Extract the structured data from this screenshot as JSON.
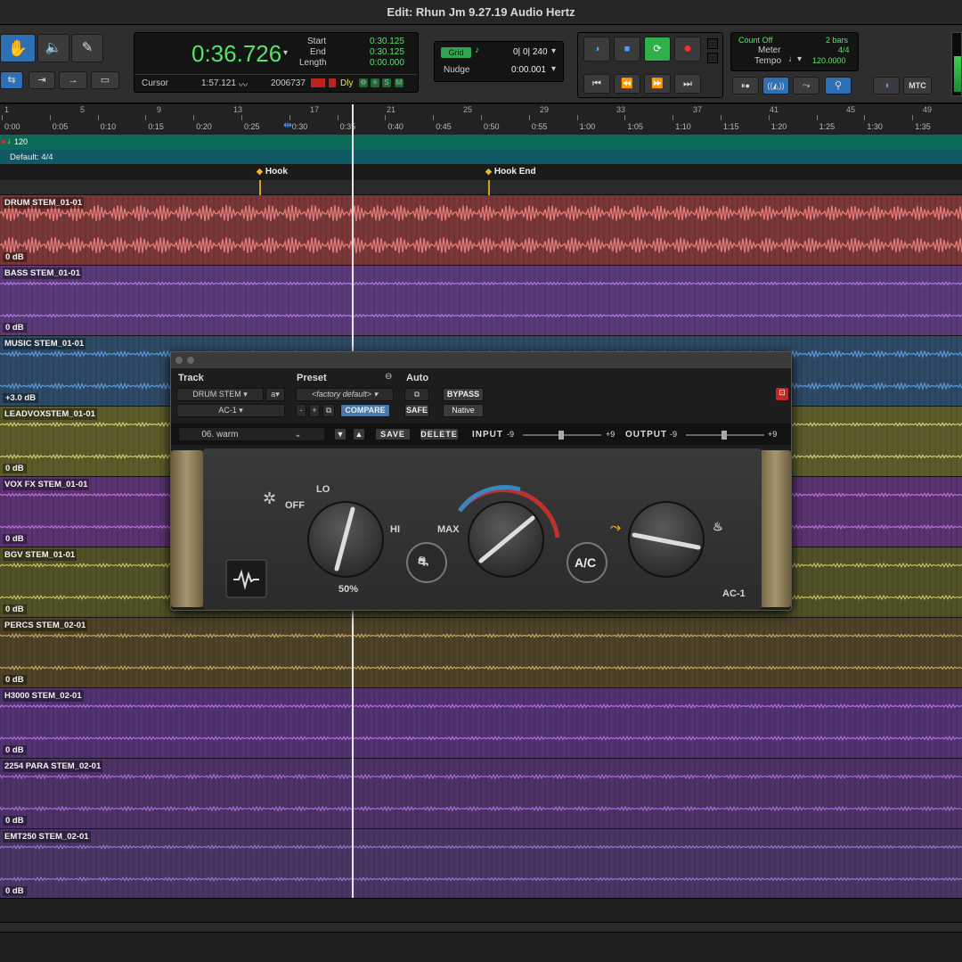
{
  "window": {
    "title": "Edit: Rhun Jm 9.27.19 Audio Hertz"
  },
  "counter": {
    "main": "0:36.726",
    "start_label": "Start",
    "end_label": "End",
    "length_label": "Length",
    "start": "0:30.125",
    "end": "0:30.125",
    "length": "0:00.000",
    "cursor_label": "Cursor",
    "cursor": "1:57.121",
    "sample": "2006737",
    "dly": "Dly",
    "btn_o": "O",
    "btn_s": "S",
    "btn_m": "M"
  },
  "grid": {
    "label": "Grid",
    "value": "0| 0| 240",
    "nudge_label": "Nudge",
    "nudge_value": "0:00.001"
  },
  "midi": {
    "count_off": "Count Off",
    "count_off_value": "2 bars",
    "meter_label": "Meter",
    "meter_value": "4/4",
    "tempo_label": "Tempo",
    "tempo_value": "120.0000",
    "mtc": "MTC"
  },
  "ruler": {
    "bars": [
      "1",
      "5",
      "9",
      "13",
      "17",
      "21",
      "25",
      "29",
      "33",
      "37",
      "41",
      "45",
      "49"
    ],
    "times": [
      "0:00",
      "0:05",
      "0:10",
      "0:15",
      "0:20",
      "0:25",
      "0:30",
      "0:35",
      "0:40",
      "0:45",
      "0:50",
      "0:55",
      "1:00",
      "1:05",
      "1:10",
      "1:15",
      "1:20",
      "1:25",
      "1:30",
      "1:35"
    ]
  },
  "tempo_ruler": {
    "value": "120"
  },
  "meter_ruler": {
    "value": "Default: 4/4"
  },
  "markers": [
    {
      "name": "Hook"
    },
    {
      "name": "Hook End"
    }
  ],
  "tracks": [
    {
      "name": "DRUM STEM_01-01",
      "vol": "0 dB",
      "bg": "#7a3838",
      "wave": "#e07a7a"
    },
    {
      "name": "BASS STEM_01-01",
      "vol": "0 dB",
      "bg": "#5a3a78",
      "wave": "#b07ae0"
    },
    {
      "name": "MUSIC STEM_01-01",
      "vol": "+3.0 dB",
      "bg": "#2f4a66",
      "wave": "#5a9ae0"
    },
    {
      "name": "LEADVOXSTEM_01-01",
      "vol": "0 dB",
      "bg": "#5c5c2a",
      "wave": "#d0d070"
    },
    {
      "name": "VOX FX STEM_01-01",
      "vol": "0 dB",
      "bg": "#5a3370",
      "wave": "#c070e0"
    },
    {
      "name": "BGV STEM_01-01",
      "vol": "0 dB",
      "bg": "#525228",
      "wave": "#c8c060"
    },
    {
      "name": "PERCS STEM_02-01",
      "vol": "0 dB",
      "bg": "#4e4228",
      "wave": "#c8a860"
    },
    {
      "name": "H3000 STEM_02-01",
      "vol": "0 dB",
      "bg": "#523270",
      "wave": "#b070e0"
    },
    {
      "name": "2254 PARA STEM_02-01",
      "vol": "0 dB",
      "bg": "#4e3268",
      "wave": "#a870d8"
    },
    {
      "name": "EMT250 STEM_02-01",
      "vol": "0 dB",
      "bg": "#4a3564",
      "wave": "#9c74d0"
    }
  ],
  "plugin": {
    "track_label": "Track",
    "preset_label": "Preset",
    "auto_label": "Auto",
    "track_value": "DRUM STEM",
    "track_slot": "a",
    "insert_value": "AC-1",
    "preset_value": "<factory default>",
    "compare": "COMPARE",
    "bypass": "BYPASS",
    "safe": "SAFE",
    "native": "Native",
    "preset_name": "06. warm",
    "save": "SAVE",
    "delete": "DELETE",
    "input_label": "INPUT",
    "output_label": "OUTPUT",
    "min": "-9",
    "max": "+9",
    "fan_off": "OFF",
    "fan_lo": "LO",
    "fan_hi": "HI",
    "fan_value": "50%",
    "temp_max": "MAX",
    "ac": "A/C",
    "model": "AC-1"
  }
}
